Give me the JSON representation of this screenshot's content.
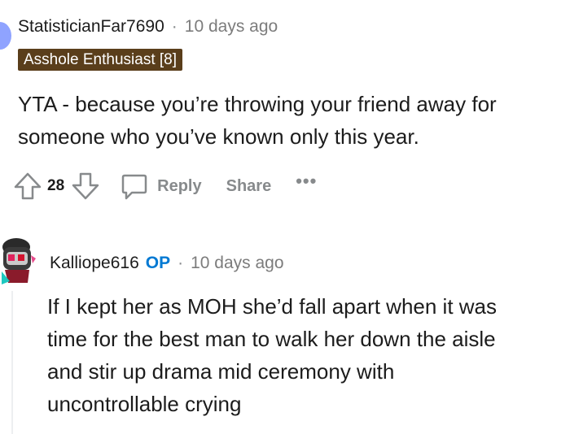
{
  "comment1": {
    "author": "StatisticianFar7690",
    "separator": "·",
    "time": "10 days ago",
    "flair": "Asshole Enthusiast [8]",
    "body_lines": [
      "YTA - because you’re throwing your friend away for",
      "someone who you’ve known only this year."
    ],
    "score": "28",
    "actions": {
      "reply": "Reply",
      "share": "Share",
      "more": "•••"
    },
    "icons": [
      "upvote-arrow-icon",
      "downvote-arrow-icon",
      "comment-bubble-icon"
    ]
  },
  "comment2": {
    "author": "Kalliope616",
    "op_badge": "OP",
    "separator": "·",
    "time": "10 days ago",
    "body_lines": [
      "If I kept her as MOH she’d fall apart when it was",
      "time for the best man to walk her down the aisle",
      "and stir up drama mid ceremony with",
      "uncontrollable crying"
    ]
  },
  "colors": {
    "flair_bg": "#5a3e1b",
    "op_blue": "#0079d3",
    "muted_gray": "#878a8c",
    "avatar1": "#8fa3ff"
  }
}
